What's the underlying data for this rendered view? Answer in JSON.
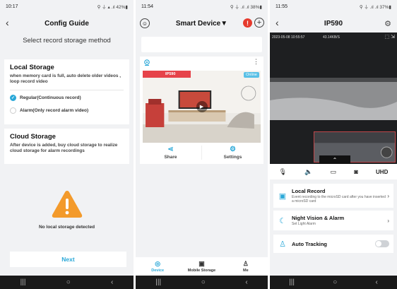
{
  "panel1": {
    "status": {
      "time": "10:17",
      "right": "⚲ ⏚ ▴ .ıl 42%▮"
    },
    "nav": {
      "title": "Config Guide"
    },
    "subtitle": "Select record storage method",
    "local": {
      "title": "Local Storage",
      "desc": "when  memory card is full, auto delete older videos , loop record video",
      "options": [
        "Regular(Continuous record)",
        "Alarm(Only record alarm video)"
      ]
    },
    "cloud": {
      "title": "Cloud Storage",
      "desc": "After device is added, buy cloud storage to realize cloud storage for alarm recordings"
    },
    "warning_text": "No local storage detected",
    "next_label": "Next"
  },
  "panel2": {
    "status": {
      "time": "11:54",
      "right": "⚲ ⏚ .ıl .ıl 38%▮"
    },
    "nav": {
      "title": "Smart Device▼"
    },
    "device": {
      "tag": "IP590",
      "online": "Online"
    },
    "actions": {
      "share": "Share",
      "settings": "Settings"
    },
    "tabs": [
      "Device",
      "Mobile Storage",
      "Me"
    ]
  },
  "panel3": {
    "status": {
      "time": "11:55",
      "right": "⚲ ⏚ .ıl .ıl 37%▮"
    },
    "nav": {
      "title": "IP590"
    },
    "video": {
      "timestamp": "2023-05-08 10:55:57",
      "rate": "43.14KB/S"
    },
    "controls": {
      "quality": "UHD"
    },
    "rows": [
      {
        "title": "Local Record",
        "sub": "Event recording to the microSD card after you have inserted a microSD card"
      },
      {
        "title": "Night Vision & Alarm",
        "sub": "Set Light Alarm"
      },
      {
        "title": "Auto Tracking",
        "sub": ""
      }
    ]
  },
  "sysnav": {
    "recent": "|||",
    "home": "○",
    "back": "‹"
  },
  "colors": {
    "accent": "#2aa8d8",
    "alert": "#e63b2e",
    "tag": "#e6434a"
  }
}
